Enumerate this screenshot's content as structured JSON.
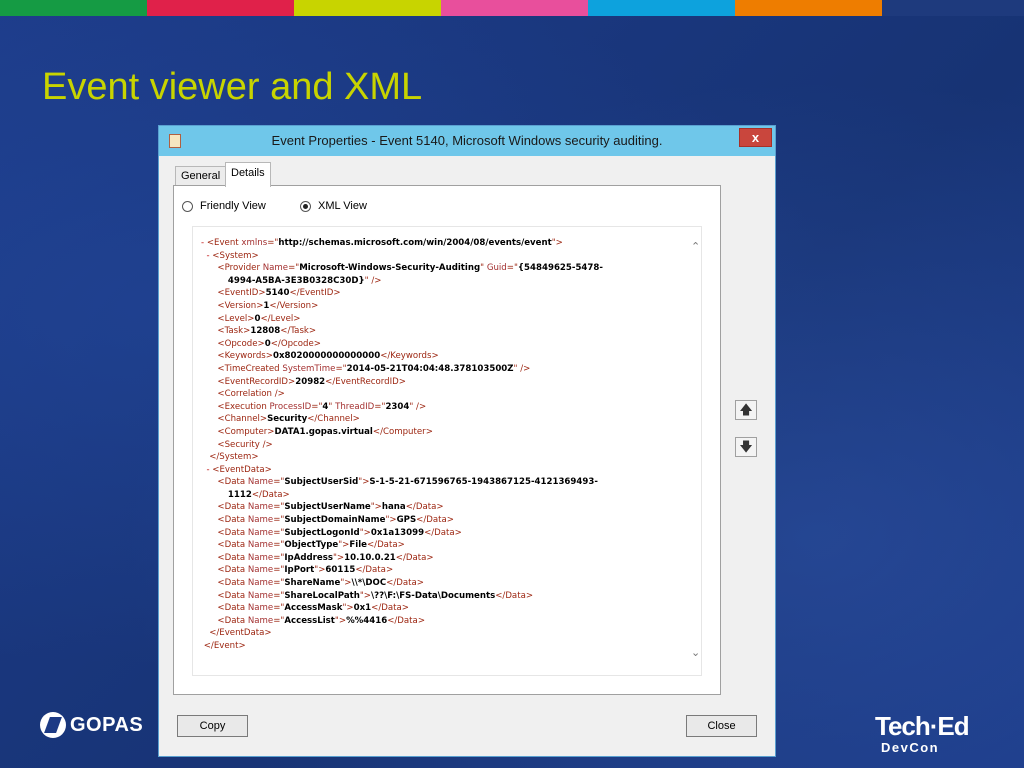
{
  "strip_colors": [
    "#159b44",
    "#e0214a",
    "#c8d400",
    "#e84f9c",
    "#0da2dd",
    "#ee7d00",
    "#1e3a7d"
  ],
  "slide": {
    "title": "Event viewer and XML"
  },
  "dialog": {
    "title": "Event Properties - Event 5140, Microsoft Windows security auditing.",
    "close_label": "x",
    "tabs": [
      {
        "label": "General"
      },
      {
        "label": "Details"
      }
    ],
    "active_tab": "Details",
    "views": [
      {
        "label": "Friendly View",
        "selected": false
      },
      {
        "label": "XML View",
        "selected": true
      }
    ],
    "xml_lines": [
      [
        [
          "minus",
          "- "
        ],
        [
          "t",
          "<Event "
        ],
        [
          "an",
          "xmlns"
        ],
        [
          "t",
          "=\""
        ],
        [
          "av",
          "http://schemas.microsoft.com/win/2004/08/events/event"
        ],
        [
          "t",
          "\">"
        ]
      ],
      [
        [
          "minus",
          "  - "
        ],
        [
          "t",
          "<System>"
        ]
      ],
      [
        [
          "t",
          "      <Provider "
        ],
        [
          "an",
          "Name"
        ],
        [
          "t",
          "=\""
        ],
        [
          "av",
          "Microsoft-Windows-Security-Auditing"
        ],
        [
          "t",
          "\" "
        ],
        [
          "an",
          "Guid"
        ],
        [
          "t",
          "=\""
        ],
        [
          "av",
          "{54849625-5478-"
        ]
      ],
      [
        [
          "av",
          "         4994-A5BA-3E3B0328C30D}"
        ],
        [
          "t",
          "\" />"
        ]
      ],
      [
        [
          "t",
          "      <EventID>"
        ],
        [
          "av",
          "5140"
        ],
        [
          "t",
          "</EventID>"
        ]
      ],
      [
        [
          "t",
          "      <Version>"
        ],
        [
          "av",
          "1"
        ],
        [
          "t",
          "</Version>"
        ]
      ],
      [
        [
          "t",
          "      <Level>"
        ],
        [
          "av",
          "0"
        ],
        [
          "t",
          "</Level>"
        ]
      ],
      [
        [
          "t",
          "      <Task>"
        ],
        [
          "av",
          "12808"
        ],
        [
          "t",
          "</Task>"
        ]
      ],
      [
        [
          "t",
          "      <Opcode>"
        ],
        [
          "av",
          "0"
        ],
        [
          "t",
          "</Opcode>"
        ]
      ],
      [
        [
          "t",
          "      <Keywords>"
        ],
        [
          "av",
          "0x8020000000000000"
        ],
        [
          "t",
          "</Keywords>"
        ]
      ],
      [
        [
          "t",
          "      <TimeCreated "
        ],
        [
          "an",
          "SystemTime"
        ],
        [
          "t",
          "=\""
        ],
        [
          "av",
          "2014-05-21T04:04:48.378103500Z"
        ],
        [
          "t",
          "\" />"
        ]
      ],
      [
        [
          "t",
          "      <EventRecordID>"
        ],
        [
          "av",
          "20982"
        ],
        [
          "t",
          "</EventRecordID>"
        ]
      ],
      [
        [
          "t",
          "      <Correlation />"
        ]
      ],
      [
        [
          "t",
          "      <Execution "
        ],
        [
          "an",
          "ProcessID"
        ],
        [
          "t",
          "=\""
        ],
        [
          "av",
          "4"
        ],
        [
          "t",
          "\" "
        ],
        [
          "an",
          "ThreadID"
        ],
        [
          "t",
          "=\""
        ],
        [
          "av",
          "2304"
        ],
        [
          "t",
          "\" />"
        ]
      ],
      [
        [
          "t",
          "      <Channel>"
        ],
        [
          "av",
          "Security"
        ],
        [
          "t",
          "</Channel>"
        ]
      ],
      [
        [
          "t",
          "      <Computer>"
        ],
        [
          "av",
          "DATA1.gopas.virtual"
        ],
        [
          "t",
          "</Computer>"
        ]
      ],
      [
        [
          "t",
          "      <Security />"
        ]
      ],
      [
        [
          "t",
          "   </System>"
        ]
      ],
      [
        [
          "minus",
          "  - "
        ],
        [
          "t",
          "<EventData>"
        ]
      ],
      [
        [
          "t",
          "      <Data "
        ],
        [
          "an",
          "Name"
        ],
        [
          "t",
          "=\""
        ],
        [
          "av",
          "SubjectUserSid"
        ],
        [
          "t",
          "\">"
        ],
        [
          "av",
          "S-1-5-21-671596765-1943867125-4121369493-"
        ]
      ],
      [
        [
          "av",
          "         1112"
        ],
        [
          "t",
          "</Data>"
        ]
      ],
      [
        [
          "t",
          "      <Data "
        ],
        [
          "an",
          "Name"
        ],
        [
          "t",
          "=\""
        ],
        [
          "av",
          "SubjectUserName"
        ],
        [
          "t",
          "\">"
        ],
        [
          "av",
          "hana"
        ],
        [
          "t",
          "</Data>"
        ]
      ],
      [
        [
          "t",
          "      <Data "
        ],
        [
          "an",
          "Name"
        ],
        [
          "t",
          "=\""
        ],
        [
          "av",
          "SubjectDomainName"
        ],
        [
          "t",
          "\">"
        ],
        [
          "av",
          "GPS"
        ],
        [
          "t",
          "</Data>"
        ]
      ],
      [
        [
          "t",
          "      <Data "
        ],
        [
          "an",
          "Name"
        ],
        [
          "t",
          "=\""
        ],
        [
          "av",
          "SubjectLogonId"
        ],
        [
          "t",
          "\">"
        ],
        [
          "av",
          "0x1a13099"
        ],
        [
          "t",
          "</Data>"
        ]
      ],
      [
        [
          "t",
          "      <Data "
        ],
        [
          "an",
          "Name"
        ],
        [
          "t",
          "=\""
        ],
        [
          "av",
          "ObjectType"
        ],
        [
          "t",
          "\">"
        ],
        [
          "av",
          "File"
        ],
        [
          "t",
          "</Data>"
        ]
      ],
      [
        [
          "t",
          "      <Data "
        ],
        [
          "an",
          "Name"
        ],
        [
          "t",
          "=\""
        ],
        [
          "av",
          "IpAddress"
        ],
        [
          "t",
          "\">"
        ],
        [
          "av",
          "10.10.0.21"
        ],
        [
          "t",
          "</Data>"
        ]
      ],
      [
        [
          "t",
          "      <Data "
        ],
        [
          "an",
          "Name"
        ],
        [
          "t",
          "=\""
        ],
        [
          "av",
          "IpPort"
        ],
        [
          "t",
          "\">"
        ],
        [
          "av",
          "60115"
        ],
        [
          "t",
          "</Data>"
        ]
      ],
      [
        [
          "t",
          "      <Data "
        ],
        [
          "an",
          "Name"
        ],
        [
          "t",
          "=\""
        ],
        [
          "av",
          "ShareName"
        ],
        [
          "t",
          "\">"
        ],
        [
          "av",
          "\\\\*\\DOC"
        ],
        [
          "t",
          "</Data>"
        ]
      ],
      [
        [
          "t",
          "      <Data "
        ],
        [
          "an",
          "Name"
        ],
        [
          "t",
          "=\""
        ],
        [
          "av",
          "ShareLocalPath"
        ],
        [
          "t",
          "\">"
        ],
        [
          "av",
          "\\??\\F:\\FS-Data\\Documents"
        ],
        [
          "t",
          "</Data>"
        ]
      ],
      [
        [
          "t",
          "      <Data "
        ],
        [
          "an",
          "Name"
        ],
        [
          "t",
          "=\""
        ],
        [
          "av",
          "AccessMask"
        ],
        [
          "t",
          "\">"
        ],
        [
          "av",
          "0x1"
        ],
        [
          "t",
          "</Data>"
        ]
      ],
      [
        [
          "t",
          "      <Data "
        ],
        [
          "an",
          "Name"
        ],
        [
          "t",
          "=\""
        ],
        [
          "av",
          "AccessList"
        ],
        [
          "t",
          "\">"
        ],
        [
          "av",
          "%%4416"
        ],
        [
          "t",
          "</Data>"
        ]
      ],
      [
        [
          "t",
          "   </EventData>"
        ]
      ],
      [
        [
          "t",
          " </Event>"
        ]
      ]
    ],
    "scroll_up_icon": "chevron-up-icon",
    "scroll_down_icon": "chevron-down-icon",
    "prev_icon": "arrow-up-icon",
    "next_icon": "arrow-down-icon",
    "copy_label": "Copy",
    "close_button_label": "Close"
  },
  "footer": {
    "gopas_logo_text": "GOPAS",
    "teched_logo_text": "Tech·Ed",
    "teched_sub_text": "DevCon"
  }
}
